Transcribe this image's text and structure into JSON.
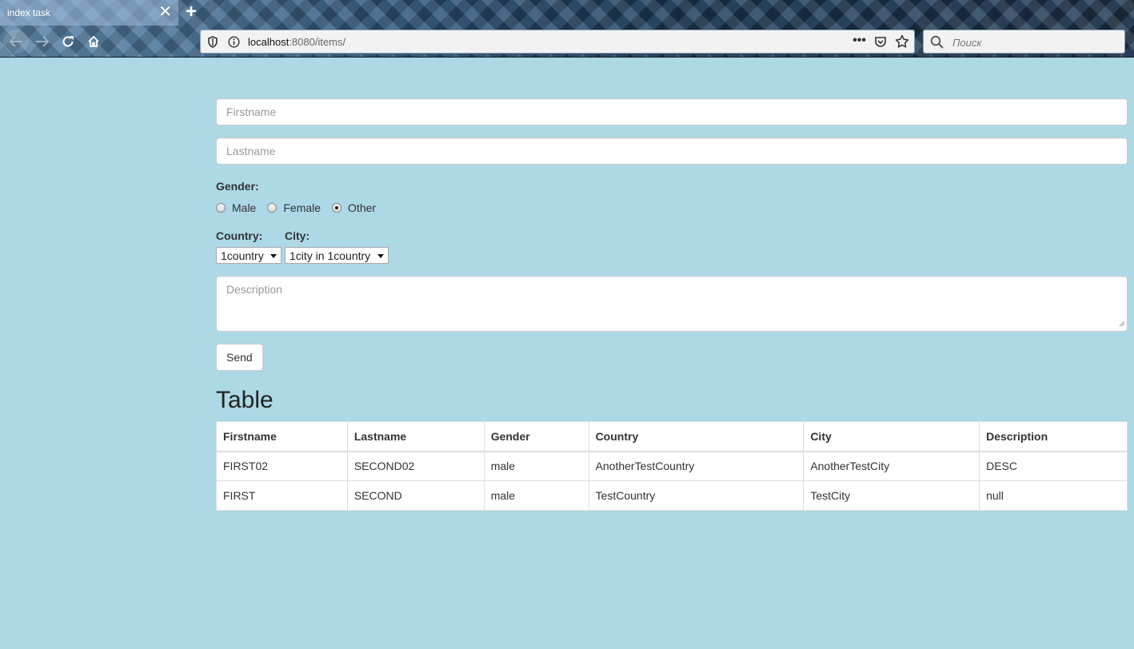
{
  "browser": {
    "tab_title": "index task",
    "url_host": "localhost",
    "url_rest": ":8080/items/",
    "search_placeholder": "Поиск"
  },
  "form": {
    "firstname_placeholder": "Firstname",
    "lastname_placeholder": "Lastname",
    "gender_label": "Gender:",
    "gender_options": [
      "Male",
      "Female",
      "Other"
    ],
    "gender_selected": "Other",
    "country_label": "Country:",
    "country_value": "1country",
    "city_label": "City:",
    "city_value": "1city in 1country",
    "description_placeholder": "Description",
    "send_label": "Send"
  },
  "table": {
    "heading": "Table",
    "columns": [
      "Firstname",
      "Lastname",
      "Gender",
      "Country",
      "City",
      "Description"
    ],
    "rows": [
      [
        "FIRST02",
        "SECOND02",
        "male",
        "AnotherTestCountry",
        "AnotherTestCity",
        "DESC"
      ],
      [
        "FIRST",
        "SECOND",
        "male",
        "TestCountry",
        "TestCity",
        "null"
      ]
    ]
  },
  "colors": {
    "page_background": "#add8e6"
  }
}
